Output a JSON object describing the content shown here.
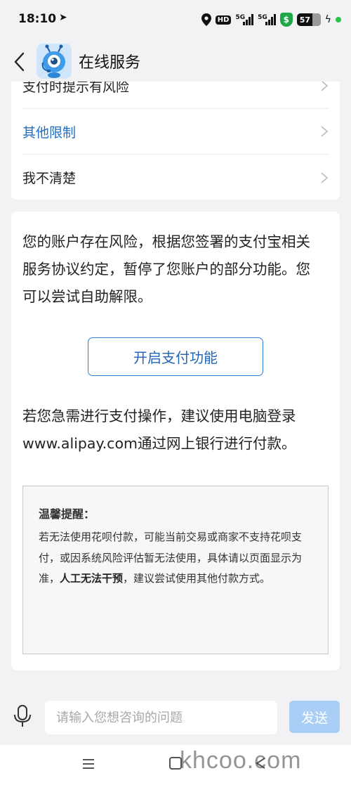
{
  "status_bar": {
    "time": "18:10",
    "battery": "57"
  },
  "header": {
    "title": "在线服务"
  },
  "menu": {
    "items": [
      {
        "label": "支付时提示有风险"
      },
      {
        "label": "其他限制"
      },
      {
        "label": "我不清楚"
      }
    ]
  },
  "info": {
    "message": "您的账户存在风险，根据您签署的支付宝相关服务协议约定，暂停了您账户的部分功能。您可以尝试自助解限。",
    "enable_button": "开启支付功能",
    "pc_notice": "若您急需进行支付操作，建议使用电脑登录www.alipay.com通过网上银行进行付款。",
    "tips": {
      "title": "温馨提醒：",
      "body_part1": "若无法使用花呗付款，可能当前交易或商家不支持花呗支付，或因系统风险评估暂无法使用，具体请以页面显示为准，",
      "body_bold": "人工无法干预",
      "body_part2": "，建议尝试使用其他付款方式。"
    }
  },
  "input_bar": {
    "placeholder": "请输入您想咨询的问题",
    "send_label": "发送"
  },
  "watermark": "khcoo.com",
  "colors": {
    "accent": "#1f6fc4",
    "send_disabled": "#aacff7",
    "background": "#f2f2f4"
  }
}
